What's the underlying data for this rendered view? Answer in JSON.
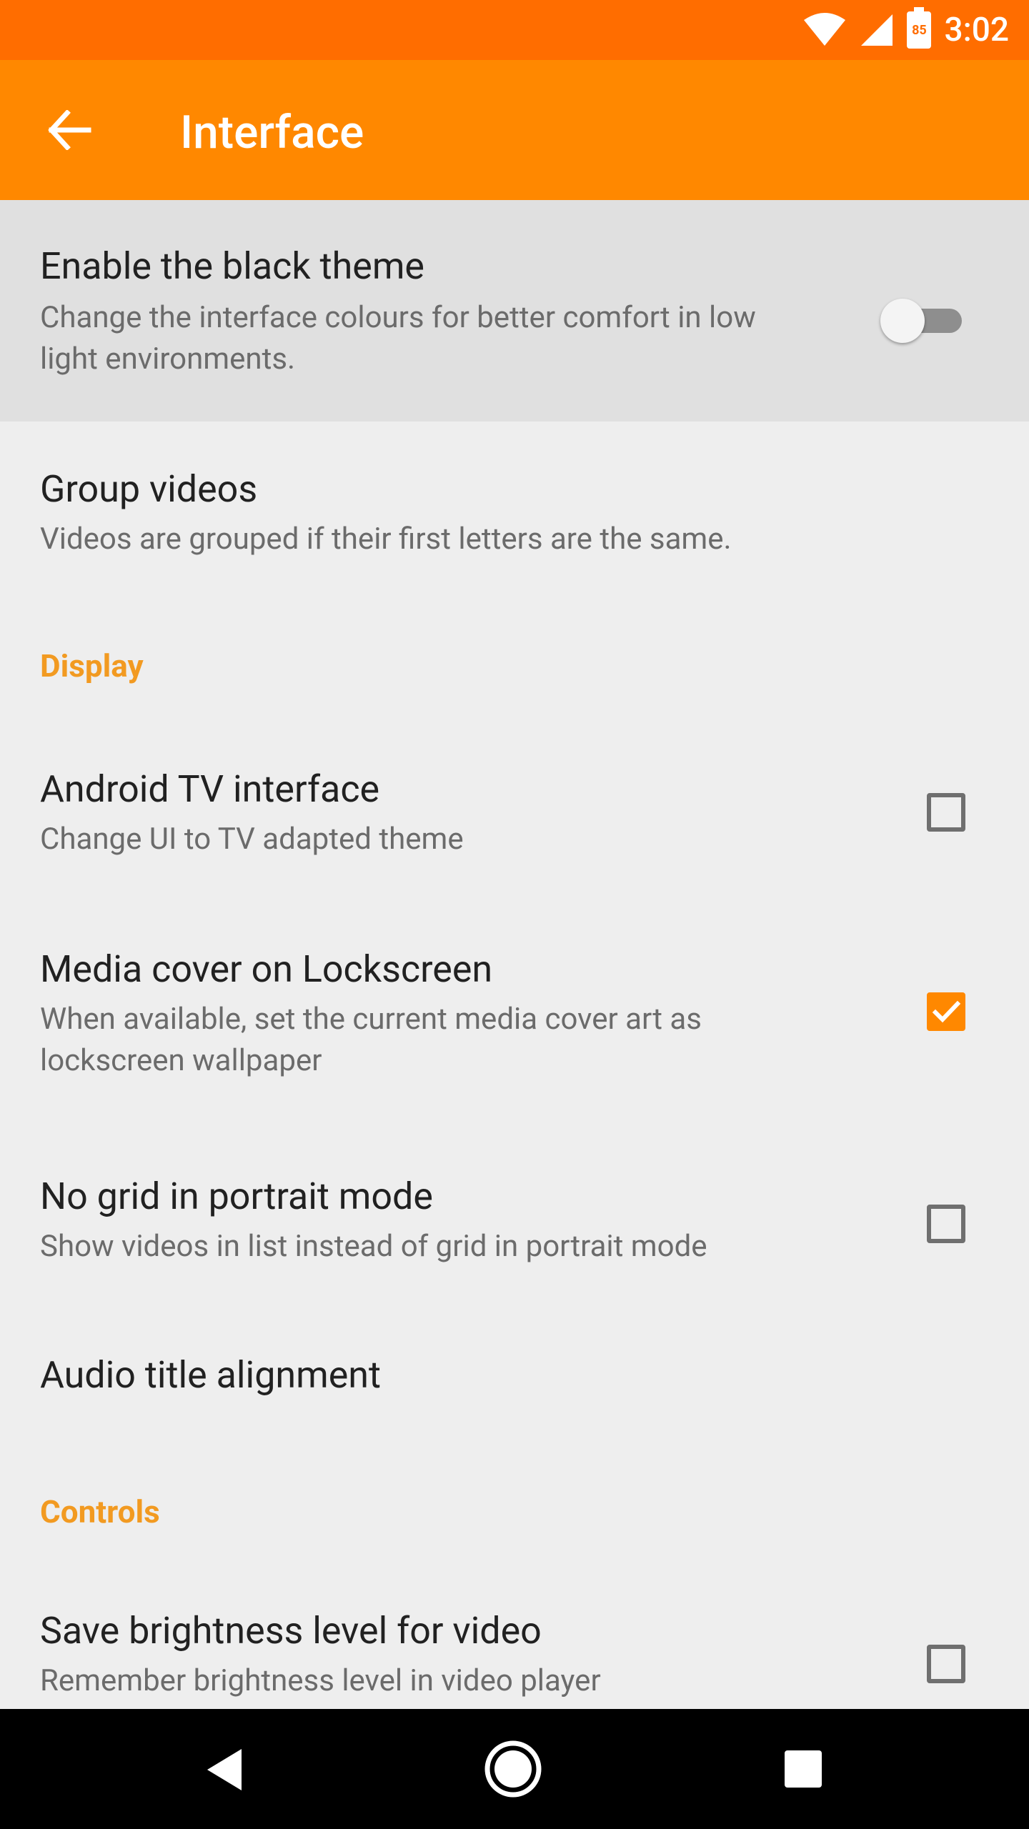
{
  "status": {
    "time": "3:02",
    "battery": "85",
    "icons": [
      "wifi-icon",
      "signal-icon",
      "battery-icon"
    ]
  },
  "toolbar": {
    "title": "Interface",
    "back_icon": "arrow-left-icon"
  },
  "prefs": {
    "black_theme": {
      "title": "Enable the black theme",
      "summary": "Change the interface colours for better comfort in low light environments.",
      "enabled": false
    },
    "group_videos": {
      "title": "Group videos",
      "summary": "Videos are grouped if their first letters are the same."
    },
    "display_category": "Display",
    "android_tv": {
      "title": "Android TV interface",
      "summary": "Change UI to TV adapted theme",
      "checked": false
    },
    "media_cover": {
      "title": "Media cover on Lockscreen",
      "summary": "When available, set the current media cover art as lockscreen wallpaper",
      "checked": true
    },
    "no_grid": {
      "title": "No grid in portrait mode",
      "summary": "Show videos in list instead of grid in portrait mode",
      "checked": false
    },
    "audio_title": {
      "title": "Audio title alignment"
    },
    "controls_category": "Controls",
    "brightness": {
      "title": "Save brightness level for video",
      "summary": "Remember brightness level in video player",
      "checked": false
    }
  },
  "colors": {
    "status_bar": "#FF6D00",
    "toolbar": "#FF8800",
    "accent": "#F29A21",
    "background": "#EEEEEE"
  },
  "navbar": {
    "icons": [
      "back-triangle-icon",
      "home-circle-icon",
      "recents-square-icon"
    ]
  }
}
